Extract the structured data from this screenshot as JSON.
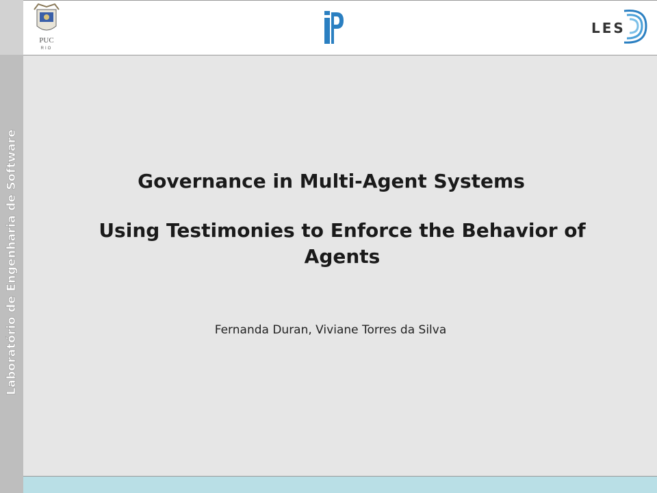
{
  "sidebar": {
    "vertical_label": "Laboratório de Engenharia de Software"
  },
  "header": {
    "logos": [
      {
        "name": "puc-rio-logo",
        "text": "PUC",
        "subtext": "RIO"
      },
      {
        "name": "ipp-logo"
      },
      {
        "name": "les-logo",
        "text": "LES"
      }
    ]
  },
  "slide": {
    "title": "Governance in Multi-Agent Systems",
    "subtitle": "Using Testimonies to Enforce the Behavior of Agents",
    "authors": "Fernanda Duran, Viviane Torres da Silva"
  },
  "colors": {
    "content_bg": "#e6e6e6",
    "sidebar_bg": "#bebebe",
    "footer_bg": "#b9dfe6",
    "logo_blue": "#2a7fc1"
  }
}
